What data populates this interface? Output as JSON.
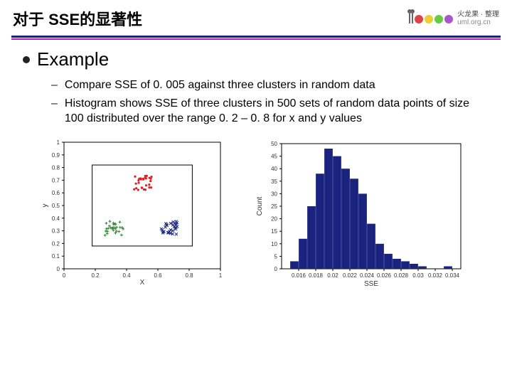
{
  "header": {
    "title": "对于 SSE的显著性",
    "logo": {
      "cn": "火龙果 · 整理",
      "url": "uml.org.cn"
    }
  },
  "section": {
    "heading": "Example",
    "items": [
      "Compare SSE of 0. 005 against three clusters in random data",
      "Histogram shows SSE of three clusters in 500 sets of random data points of size 100 distributed over the range 0. 2 – 0. 8 for x and y values"
    ]
  },
  "chart_data": [
    {
      "type": "scatter",
      "title": "",
      "xlabel": "X",
      "ylabel": "y",
      "xlim": [
        0,
        1
      ],
      "ylim": [
        0,
        1
      ],
      "xticks": [
        0,
        0.2,
        0.4,
        0.6,
        0.8,
        1
      ],
      "yticks": [
        0,
        0.1,
        0.2,
        0.3,
        0.4,
        0.5,
        0.6,
        0.7,
        0.8,
        0.9,
        1
      ],
      "box": {
        "x0": 0.18,
        "y0": 0.18,
        "x1": 0.82,
        "y1": 0.82
      },
      "series": [
        {
          "name": "cluster-red",
          "color": "#d22",
          "center": [
            0.5,
            0.68
          ],
          "spread": 0.06,
          "n": 28
        },
        {
          "name": "cluster-green",
          "color": "#2a8a2a",
          "center": [
            0.32,
            0.32
          ],
          "spread": 0.06,
          "n": 28,
          "marker": "+"
        },
        {
          "name": "cluster-blue",
          "color": "#1a237e",
          "center": [
            0.68,
            0.32
          ],
          "spread": 0.06,
          "n": 28,
          "marker": "x"
        }
      ]
    },
    {
      "type": "bar",
      "title": "",
      "xlabel": "SSE",
      "ylabel": "Count",
      "xlim": [
        0.014,
        0.035
      ],
      "ylim": [
        0,
        50
      ],
      "xticks": [
        0.016,
        0.018,
        0.02,
        0.022,
        0.024,
        0.026,
        0.028,
        0.03,
        0.032,
        0.034
      ],
      "yticks": [
        0,
        5,
        10,
        15,
        20,
        25,
        30,
        35,
        40,
        45,
        50
      ],
      "categories": [
        0.0155,
        0.0165,
        0.0175,
        0.0185,
        0.0195,
        0.0205,
        0.0215,
        0.0225,
        0.0235,
        0.0245,
        0.0255,
        0.0265,
        0.0275,
        0.0285,
        0.0295,
        0.0305,
        0.0335
      ],
      "values": [
        3,
        12,
        25,
        38,
        48,
        45,
        40,
        36,
        30,
        18,
        10,
        6,
        4,
        3,
        2,
        1,
        1
      ]
    }
  ]
}
